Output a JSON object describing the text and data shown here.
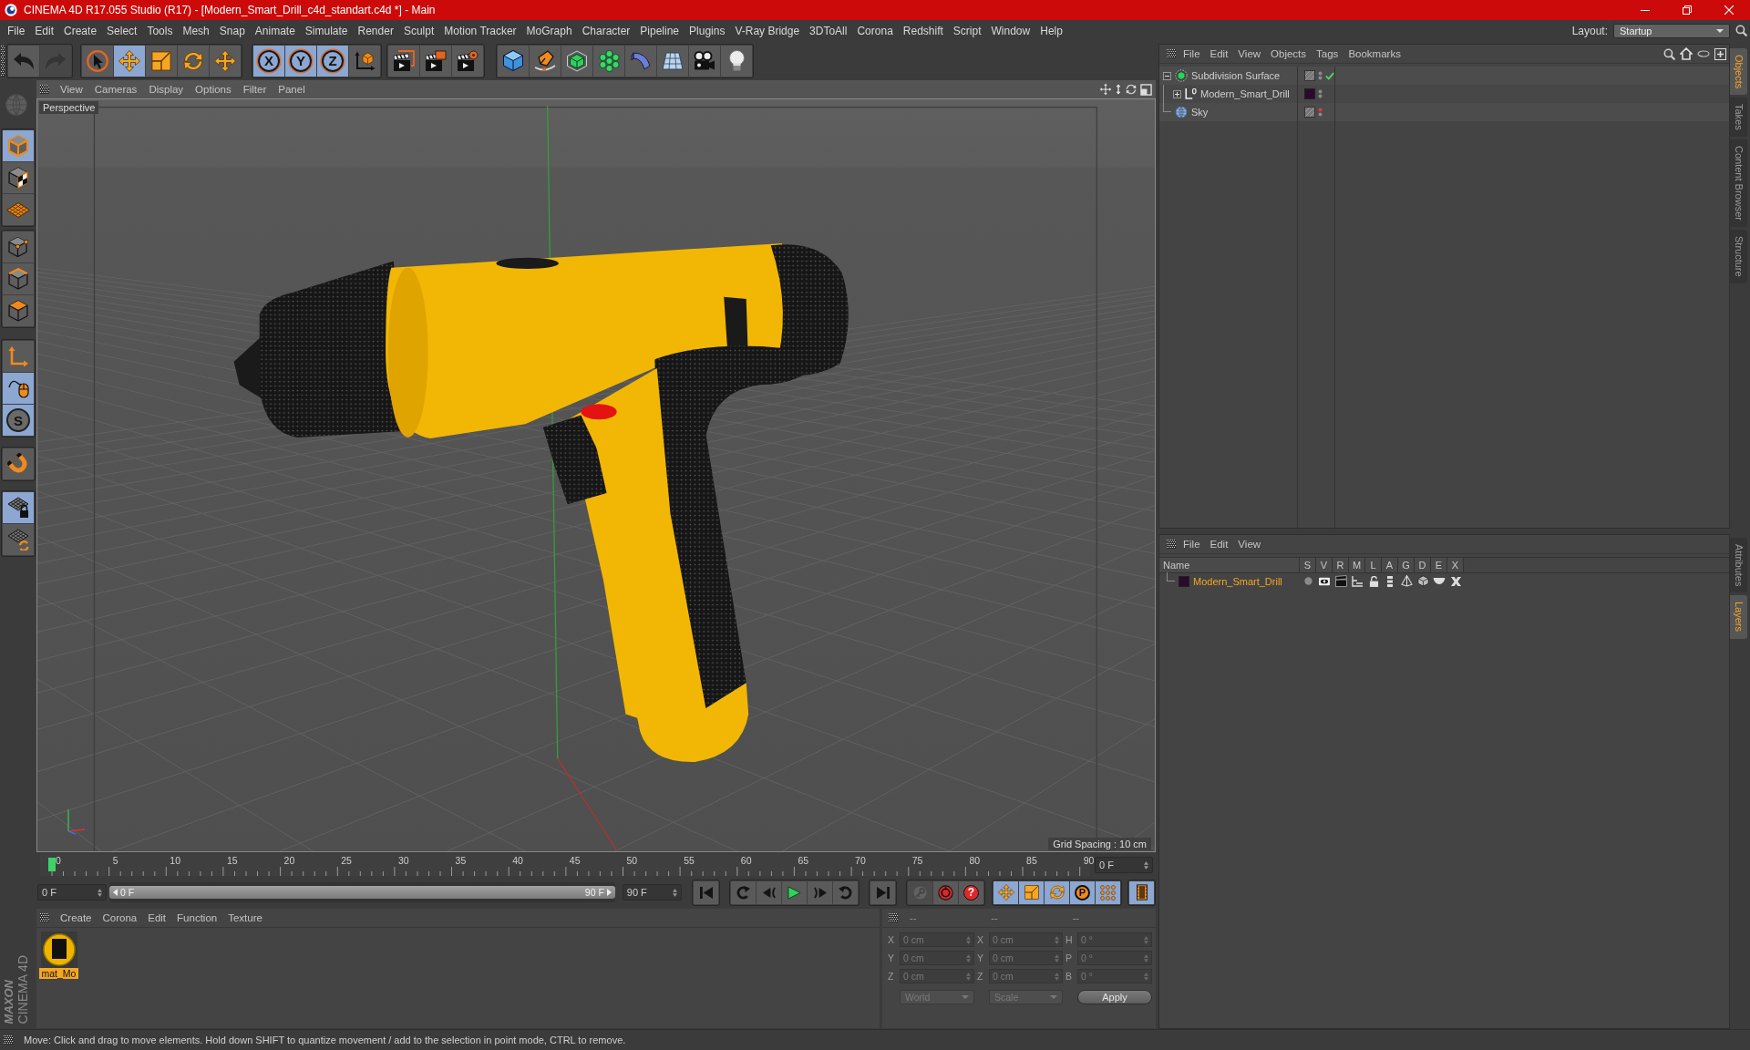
{
  "window": {
    "title": "CINEMA 4D R17.055 Studio (R17) - [Modern_Smart_Drill_c4d_standart.c4d *] - Main"
  },
  "menu_bar": [
    "File",
    "Edit",
    "Create",
    "Select",
    "Tools",
    "Mesh",
    "Snap",
    "Animate",
    "Simulate",
    "Render",
    "Sculpt",
    "Motion Tracker",
    "MoGraph",
    "Character",
    "Pipeline",
    "Plugins",
    "V-Ray Bridge",
    "3DToAll",
    "Corona",
    "Redshift",
    "Script",
    "Window",
    "Help"
  ],
  "layout": {
    "label": "Layout:",
    "value": "Startup"
  },
  "toolbar": {
    "history": [
      {
        "disabled": false
      },
      {
        "disabled": true
      }
    ],
    "tools": [
      {
        "selected": false
      },
      {
        "selected": true
      },
      {
        "selected": false
      },
      {
        "selected": false
      },
      {
        "selected": false
      }
    ],
    "axis_locks": [
      {
        "label": "X",
        "selected": true
      },
      {
        "label": "Y",
        "selected": true
      },
      {
        "label": "Z",
        "selected": true
      }
    ]
  },
  "palette": [
    [
      {
        "selected": true
      },
      {
        "selected": false
      },
      {
        "selected": false
      }
    ],
    [
      {
        "selected": false
      },
      {
        "selected": false
      },
      {
        "selected": false
      }
    ],
    [
      {
        "selected": false
      },
      {
        "selected": true
      },
      {
        "label": "S",
        "selected": true
      }
    ],
    [
      {
        "selected": false
      }
    ],
    [
      {
        "selected": true
      },
      {
        "selected": false
      }
    ]
  ],
  "viewport": {
    "menu": [
      "View",
      "Cameras",
      "Display",
      "Options",
      "Filter",
      "Panel"
    ],
    "camera": "Perspective",
    "grid_spacing": "Grid Spacing : 10 cm"
  },
  "timeline": {
    "ruler_labels": [
      "0",
      "5",
      "10",
      "15",
      "20",
      "25",
      "30",
      "35",
      "40",
      "45",
      "50",
      "55",
      "60",
      "65",
      "70",
      "75",
      "80",
      "85",
      "90"
    ],
    "level": 0,
    "current_frame": "0 F"
  },
  "playback": {
    "start_frame": "0 F",
    "range": {
      "start": "0 F",
      "end": "90 F",
      "level": 1
    },
    "end_frame": "90 F",
    "record_buttons": [
      {
        "disabled": true
      },
      {
        "disabled": false
      },
      {
        "label": "?",
        "disabled": false
      }
    ],
    "key_modes": [
      {
        "selected": true
      },
      {
        "selected": true
      },
      {
        "selected": true
      },
      {
        "label": "P",
        "selected": true
      },
      {
        "selected": true
      }
    ],
    "timeline_view": {
      "selected": true
    }
  },
  "material_manager": {
    "menu": [
      "Create",
      "Corona",
      "Edit",
      "Function",
      "Texture"
    ],
    "materials": [
      {
        "name": "mat_Mo",
        "selected": true
      }
    ]
  },
  "coordinates": {
    "headers": [
      "--",
      "--",
      "--"
    ],
    "rows": [
      {
        "labels": [
          "X",
          "X",
          "H"
        ],
        "values": [
          "0 cm",
          "0 cm",
          "0 °"
        ]
      },
      {
        "labels": [
          "Y",
          "Y",
          "P"
        ],
        "values": [
          "0 cm",
          "0 cm",
          "0 °"
        ]
      },
      {
        "labels": [
          "Z",
          "Z",
          "B"
        ],
        "values": [
          "0 cm",
          "0 cm",
          "0 °"
        ]
      }
    ],
    "dropdowns": [
      "World",
      "Scale"
    ],
    "apply": "Apply"
  },
  "object_manager": {
    "menu": [
      "File",
      "Edit",
      "View",
      "Objects",
      "Tags",
      "Bookmarks"
    ],
    "objects": [
      {
        "name": "Subdivision Surface",
        "kind": "subdivision",
        "expanded": true,
        "hidden_in_editor": false,
        "generator_enabled": true,
        "children": [
          {
            "name": "Modern_Smart_Drill",
            "kind": "null",
            "expanded": false,
            "hidden_in_editor": false,
            "color": "#2b0a2b"
          }
        ]
      },
      {
        "name": "Sky",
        "kind": "sky",
        "hidden_in_editor": true
      }
    ]
  },
  "layer_manager": {
    "menu": [
      "File",
      "Edit",
      "View"
    ],
    "columns": [
      "Name",
      "S",
      "V",
      "R",
      "M",
      "L",
      "A",
      "G",
      "D",
      "E",
      "X"
    ],
    "layers": [
      {
        "name": "Modern_Smart_Drill",
        "color": "#2b0a2b",
        "selected": true
      }
    ]
  },
  "side_tabs": {
    "upper": [
      {
        "label": "Objects",
        "selected": true
      },
      {
        "label": "Takes",
        "selected": false
      },
      {
        "label": "Content Browser",
        "selected": false
      },
      {
        "label": "Structure",
        "selected": false
      }
    ],
    "lower": [
      {
        "label": "Attributes",
        "selected": false
      },
      {
        "label": "Layers",
        "selected": true
      }
    ]
  },
  "logo": {
    "brand": "MAXON",
    "product": "CINEMA 4D"
  },
  "status_bar": "Move: Click and drag to move elements. Hold down SHIFT to quantize movement / add to the selection in point mode, CTRL to remove."
}
